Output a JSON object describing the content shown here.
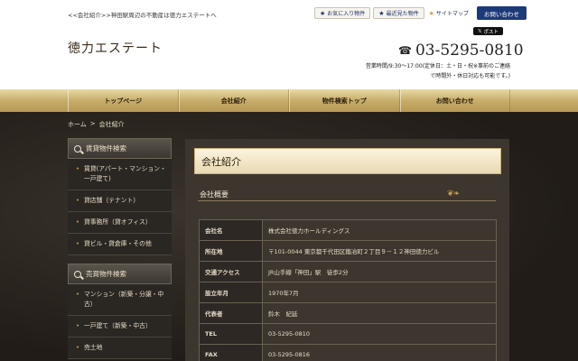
{
  "header": {
    "tagline": "<<会社紹介>>神田駅周辺の不動産は徳力エステートへ",
    "logo": "徳力エステート",
    "favorites_label": "お気に入り物件",
    "recent_label": "最近見た物件",
    "sitemap_label": "サイトマップ",
    "contact_label": "お問い合わせ",
    "xpost_label": "ポスト",
    "phone": "03-5295-0810",
    "hours_line1": "営業時間/9:30〜17:00(定休日：土・日・祝※事前のご連絡",
    "hours_line2": "で時間外・休日対応も可能です。)"
  },
  "nav": [
    {
      "label": "トップページ"
    },
    {
      "label": "会社紹介"
    },
    {
      "label": "物件検索トップ"
    },
    {
      "label": "お問い合わせ"
    }
  ],
  "breadcrumb": {
    "home": "ホーム",
    "sep": ">",
    "current": "会社紹介"
  },
  "sidebar": {
    "rent_title": "賃貸物件検索",
    "rent_items": [
      {
        "label": "賃貸(アパート・マンション・一戸建て)"
      },
      {
        "label": "貸店舗（テナント）"
      },
      {
        "label": "貸事務所（貸オフィス）"
      },
      {
        "label": "貸ビル・貸倉庫・その他"
      }
    ],
    "sale_title": "売買物件検索",
    "sale_items": [
      {
        "label": "マンション（新築・分譲・中古）"
      },
      {
        "label": "一戸建て（新築・中古）"
      },
      {
        "label": "売土地"
      }
    ]
  },
  "main": {
    "page_title": "会社紹介",
    "section_title": "会社概要",
    "rows": [
      {
        "key": "会社名",
        "value": "株式会社徳力ホールディングス"
      },
      {
        "key": "所在地",
        "value": "〒101-0044 東京都千代田区鍛冶町２丁目９－１２神田徳力ビル"
      },
      {
        "key": "交通アクセス",
        "value": "JR山手線「神田」駅　徒歩2分"
      },
      {
        "key": "設立年月",
        "value": "1970年7月"
      },
      {
        "key": "代表者",
        "value": "鈴木　紀延"
      },
      {
        "key": "TEL",
        "value": "03-5295-0810"
      },
      {
        "key": "FAX",
        "value": "03-5295-0816"
      }
    ]
  }
}
